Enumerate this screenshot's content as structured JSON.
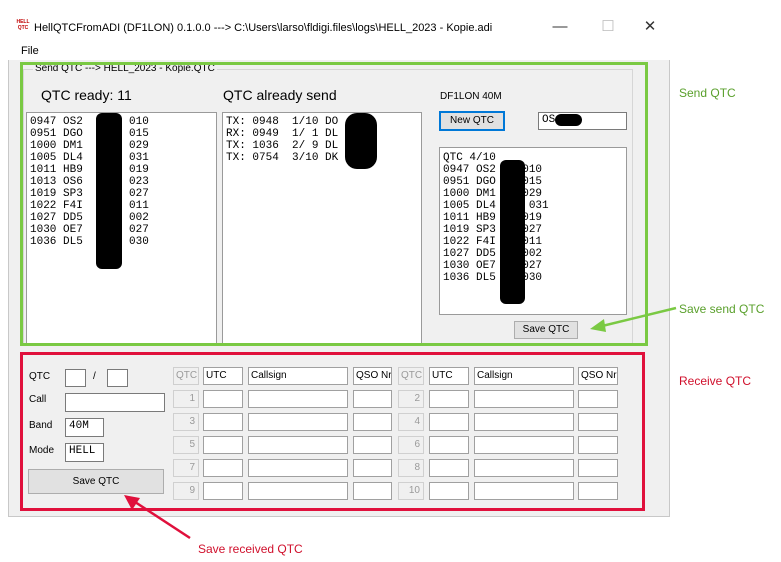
{
  "window": {
    "title": "HellQTCFromADI (DF1LON) 0.1.0.0 ---> C:\\Users\\larso\\fldigi.files\\logs\\HELL_2023 - Kopie.adi",
    "app_icon_text": "HELL QTC",
    "minimize_glyph": "—",
    "maximize_glyph": "☐",
    "close_glyph": "✕"
  },
  "menu": {
    "file": "File"
  },
  "send_group": {
    "title": "Send QTC ---> HELL_2023 - Kopie.QTC",
    "qtc_ready_label": "QTC ready: 11",
    "qtc_ready_list": [
      "0947 OS2       010",
      "0951 DGO       015",
      "1000 DM1       029",
      "1005 DL4       031",
      "1011 HB9       019",
      "1013 OS6       023",
      "1019 SP3       027",
      "1022 F4I       011",
      "1027 DD5       002",
      "1030 OE7       027",
      "1036 DL5       030"
    ],
    "already_send_label": "QTC already send",
    "already_send_list": [
      "TX: 0948  1/10 DO",
      "RX: 0949  1/ 1 DL",
      "TX: 1036  2/ 9 DL",
      "TX: 0754  3/10 DK"
    ],
    "station_label": "DF1LON 40M",
    "new_qtc_button": "New QTC",
    "callsign_value": "OS",
    "qtc_preview_list": [
      "QTC 4/10",
      "0947 OS2    010",
      "0951 DGO    015",
      "1000 DM1    029",
      "1005 DL4   X 031",
      "1011 HB9    019",
      "1019 SP3    027",
      "1022 F4I    011",
      "1027 DD5    002",
      "1030 OE7    027",
      "1036 DL5    030"
    ],
    "save_button": "Save QTC"
  },
  "receive_group": {
    "qtc_label": "QTC",
    "slash": "/",
    "call_label": "Call",
    "band_label": "Band",
    "band_value": "40M",
    "mode_label": "Mode",
    "mode_value": "HELL",
    "save_button": "Save QTC",
    "headers": [
      "QTC",
      "UTC",
      "Callsign",
      "QSO Nr"
    ],
    "left_rows": [
      "1",
      "3",
      "5",
      "7",
      "9"
    ],
    "right_rows": [
      "2",
      "4",
      "6",
      "8",
      "10"
    ]
  },
  "annotations": {
    "send_qtc": "Send QTC",
    "save_send_qtc": "Save send QTC",
    "receive_qtc": "Receive QTC",
    "save_received_qtc": "Save received QTC"
  },
  "colors": {
    "green_highlight": "#7ac943",
    "red_highlight": "#e0103c",
    "window_bg": "#f0f0f0",
    "focus_blue": "#0078d7"
  }
}
